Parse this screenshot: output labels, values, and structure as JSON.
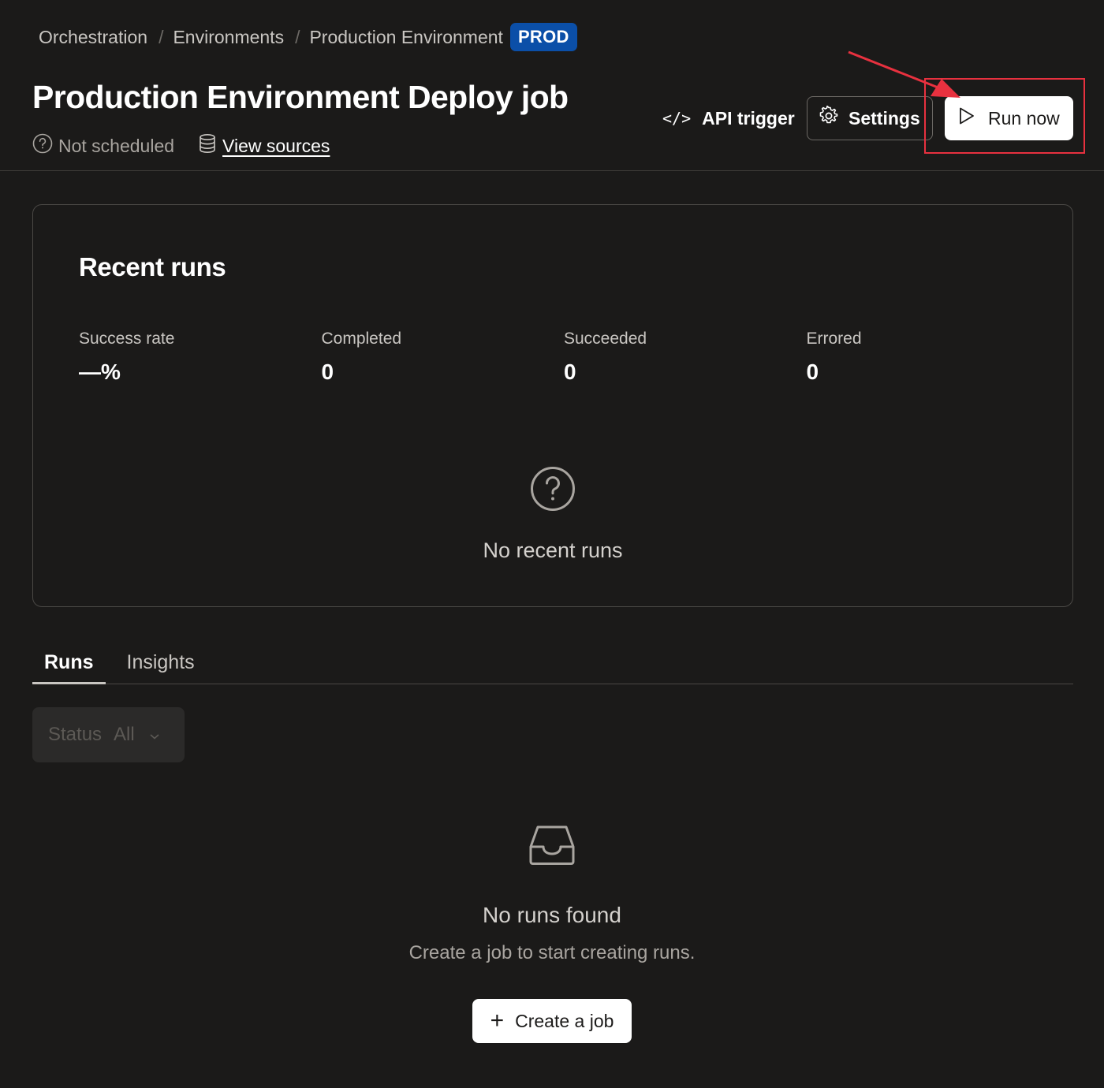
{
  "breadcrumb": {
    "items": [
      "Orchestration",
      "Environments",
      "Production Environment"
    ],
    "separator": "/",
    "badge": "PROD",
    "badge_color": "#0b4fa8"
  },
  "job": {
    "title": "Production Environment Deploy job",
    "schedule_status": "Not scheduled",
    "view_sources_label": "View sources"
  },
  "actions": {
    "api_trigger_icon": "</>",
    "api_trigger_label": "API trigger",
    "settings_label": "Settings",
    "run_now_label": "Run now"
  },
  "recent_runs": {
    "title": "Recent runs",
    "stats": [
      {
        "label": "Success rate",
        "value": "—%"
      },
      {
        "label": "Completed",
        "value": "0"
      },
      {
        "label": "Succeeded",
        "value": "0"
      },
      {
        "label": "Errored",
        "value": "0"
      }
    ],
    "empty_text": "No recent runs"
  },
  "tabs": [
    {
      "label": "Runs",
      "active": true
    },
    {
      "label": "Insights",
      "active": false
    }
  ],
  "filter": {
    "label": "Status",
    "value": "All"
  },
  "empty_state": {
    "title": "No runs found",
    "subtitle": "Create a job to start creating runs.",
    "button_label": "Create a job",
    "button_icon": "+"
  },
  "colors": {
    "background": "#1b1a19",
    "highlight": "#e8313f",
    "badge": "#0b4fa8"
  }
}
